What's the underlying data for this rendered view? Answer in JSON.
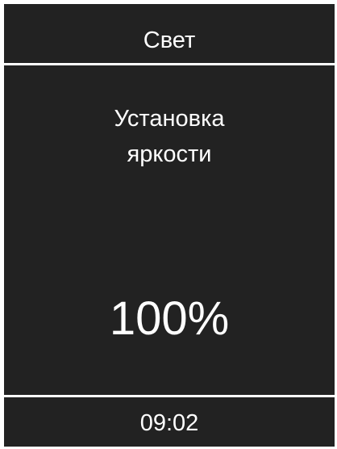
{
  "header": {
    "title": "Свет"
  },
  "setting": {
    "label_line1": "Установка",
    "label_line2": "яркости",
    "value": "100%"
  },
  "footer": {
    "time": "09:02"
  },
  "colors": {
    "background": "#222222",
    "foreground": "#ffffff",
    "frame": "#ffffff"
  }
}
